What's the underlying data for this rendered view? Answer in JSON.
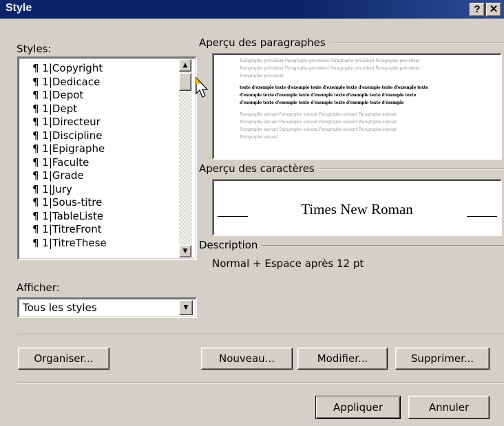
{
  "window": {
    "title": "Style",
    "help_label": "?",
    "close_label": "✕"
  },
  "styles_label": "Styles:",
  "styles_list": [
    {
      "prefix": "¶ 1|",
      "name": "Copyright"
    },
    {
      "prefix": "¶ 1|",
      "name": "Dedicace"
    },
    {
      "prefix": "¶ 1|",
      "name": "Depot"
    },
    {
      "prefix": "¶ 1|",
      "name": "Dept"
    },
    {
      "prefix": "¶ 1|",
      "name": "Directeur"
    },
    {
      "prefix": "¶ 1|",
      "name": "Discipline"
    },
    {
      "prefix": "¶ 1|",
      "name": "Epigraphe"
    },
    {
      "prefix": "¶ 1|",
      "name": "Faculte"
    },
    {
      "prefix": "¶ 1|",
      "name": "Grade"
    },
    {
      "prefix": "¶ 1|",
      "name": "Jury"
    },
    {
      "prefix": "¶ 1|",
      "name": "Sous-titre"
    },
    {
      "prefix": "¶ 1|",
      "name": "TableListe"
    },
    {
      "prefix": "¶ 1|",
      "name": "TitreFront"
    },
    {
      "prefix": "¶ 1|",
      "name": "TitreThese"
    }
  ],
  "afficher": {
    "label": "Afficher:",
    "selected": "Tous les styles"
  },
  "paragraph_preview": {
    "label": "Aperçu des paragraphes",
    "prev_lines": [
      "Paragraphe précédent Paragraphe précédent Paragraphe précédent Paragraphe précédent",
      "Paragraphe précédent Paragraphe précédent Paragraphe précédent Paragraphe précédent",
      "Paragraphe précédent"
    ],
    "sample_lines": [
      "texte d'exemple texte d'exemple texte d'exemple texte d'exemple texte d'exemple texte",
      "d'exemple texte d'exemple texte d'exemple texte d'exemple texte d'exemple texte",
      "d'exemple texte d'exemple texte d'exemple texte d'exemple texte d'exemple"
    ],
    "next_lines": [
      "Paragraphe suivant Paragraphe suivant Paragraphe suivant Paragraphe suivant",
      "Paragraphe suivant Paragraphe suivant Paragraphe suivant Paragraphe suivant",
      "Paragraphe suivant Paragraphe suivant Paragraphe suivant Paragraphe suivant",
      "Paragraphe suivant"
    ]
  },
  "character_preview": {
    "label": "Aperçu des caractères",
    "sample": "Times New Roman"
  },
  "description": {
    "label": "Description",
    "text": "Normal + Espace après 12 pt"
  },
  "buttons": {
    "organiser": "Organiser...",
    "nouveau": "Nouveau...",
    "modifier": "Modifier...",
    "supprimer": "Supprimer...",
    "appliquer": "Appliquer",
    "annuler": "Annuler"
  },
  "icons": {
    "scroll_up": "▲",
    "scroll_down": "▼",
    "dropdown": "▼",
    "cursor": "mouse-pointer-icon"
  },
  "colors": {
    "titlebar": "#0a246a",
    "face": "#d4d0c8"
  }
}
